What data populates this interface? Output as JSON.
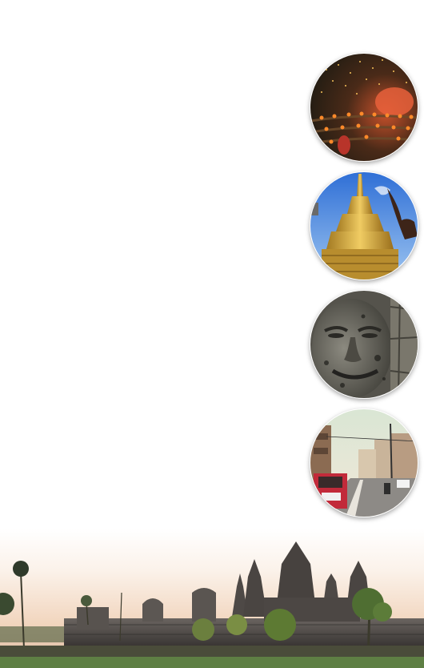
{
  "nav_circles": [
    {
      "id": "lantern-festival",
      "icon": "lantern-festival-photo"
    },
    {
      "id": "golden-stupa",
      "icon": "golden-stupa-photo"
    },
    {
      "id": "stone-face",
      "icon": "stone-face-photo"
    },
    {
      "id": "city-street",
      "icon": "city-street-photo"
    }
  ],
  "banner": {
    "icon": "temple-panorama-photo"
  },
  "colors": {
    "background": "#ffffff",
    "lantern_glow": "#f5a623",
    "stupa_gold": "#d4a93a",
    "sky_blue": "#3f7fd8",
    "stone_grey": "#6b6b63",
    "sunset_sky": "#f3dcc9"
  }
}
